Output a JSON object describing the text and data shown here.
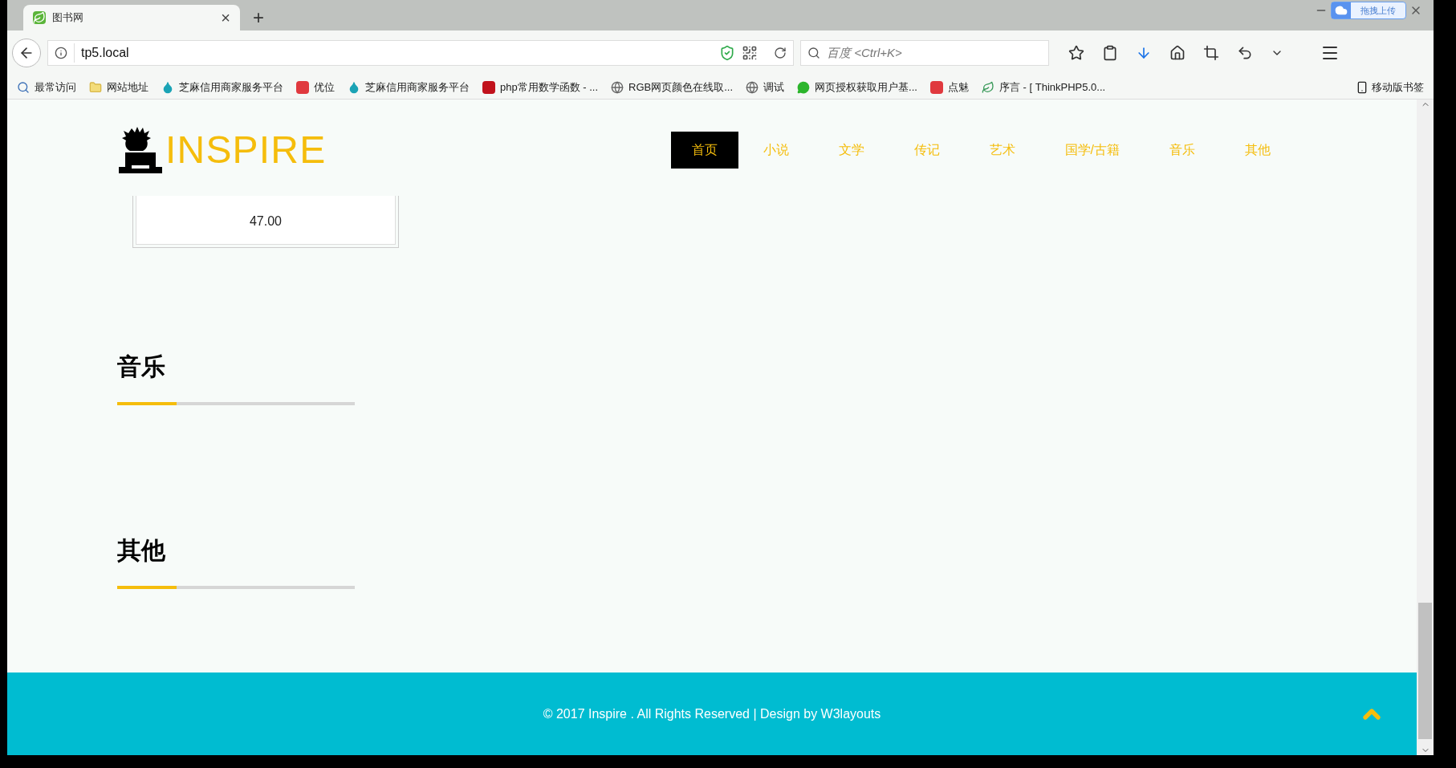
{
  "browser": {
    "tab_title": "图书网",
    "tab_close": "×",
    "new_tab": "+",
    "upload_badge": "拖拽上传",
    "url": "tp5.local",
    "search_placeholder": "百度 <Ctrl+K>",
    "bookmarks": [
      {
        "label": "最常访问",
        "kind": "search"
      },
      {
        "label": "网站地址",
        "kind": "folder"
      },
      {
        "label": "芝麻信用商家服务平台",
        "kind": "drop"
      },
      {
        "label": "优位",
        "kind": "red"
      },
      {
        "label": "芝麻信用商家服务平台",
        "kind": "drop"
      },
      {
        "label": "php常用数学函数 - ...",
        "kind": "c"
      },
      {
        "label": "RGB网页颜色在线取...",
        "kind": "globe"
      },
      {
        "label": "调试",
        "kind": "globe"
      },
      {
        "label": "网页授权获取用户基...",
        "kind": "chat"
      },
      {
        "label": "点魅",
        "kind": "red"
      },
      {
        "label": "序言 - [ ThinkPHP5.0...",
        "kind": "leaf"
      }
    ],
    "mobile_bookmarks": "移动版书签"
  },
  "site": {
    "logo": "INSPIRE",
    "nav": [
      {
        "label": "首页",
        "selected": true
      },
      {
        "label": "小说",
        "selected": false
      },
      {
        "label": "文学",
        "selected": false
      },
      {
        "label": "传记",
        "selected": false
      },
      {
        "label": "艺术",
        "selected": false
      },
      {
        "label": "国学/古籍",
        "selected": false
      },
      {
        "label": "音乐",
        "selected": false
      },
      {
        "label": "其他",
        "selected": false
      }
    ],
    "book_card": {
      "price": "47.00"
    },
    "sections": [
      {
        "title": "音乐"
      },
      {
        "title": "其他"
      }
    ],
    "footer": "© 2017 Inspire . All Rights Reserved | Design by W3layouts"
  }
}
